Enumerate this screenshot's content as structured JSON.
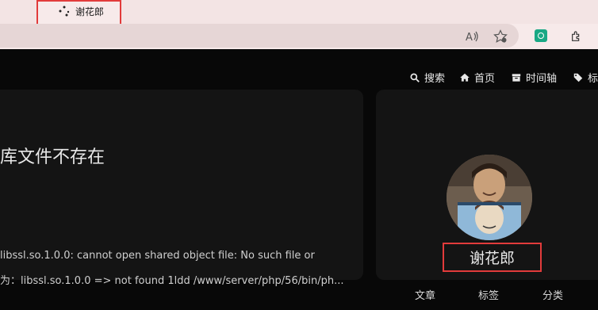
{
  "browser": {
    "tab_title": "谢花郎"
  },
  "nav": {
    "search": "搜索",
    "home": "首页",
    "timeline": "时间轴",
    "tags": "标"
  },
  "post": {
    "title": "库文件不存在",
    "line1": "libssl.so.1.0.0: cannot open shared object file: No such file or",
    "line2": "为：libssl.so.1.0.0 => not found 1ldd /www/server/php/56/bin/ph..."
  },
  "profile": {
    "name": "谢花郎",
    "stats": [
      "文章",
      "标签",
      "分类"
    ]
  }
}
